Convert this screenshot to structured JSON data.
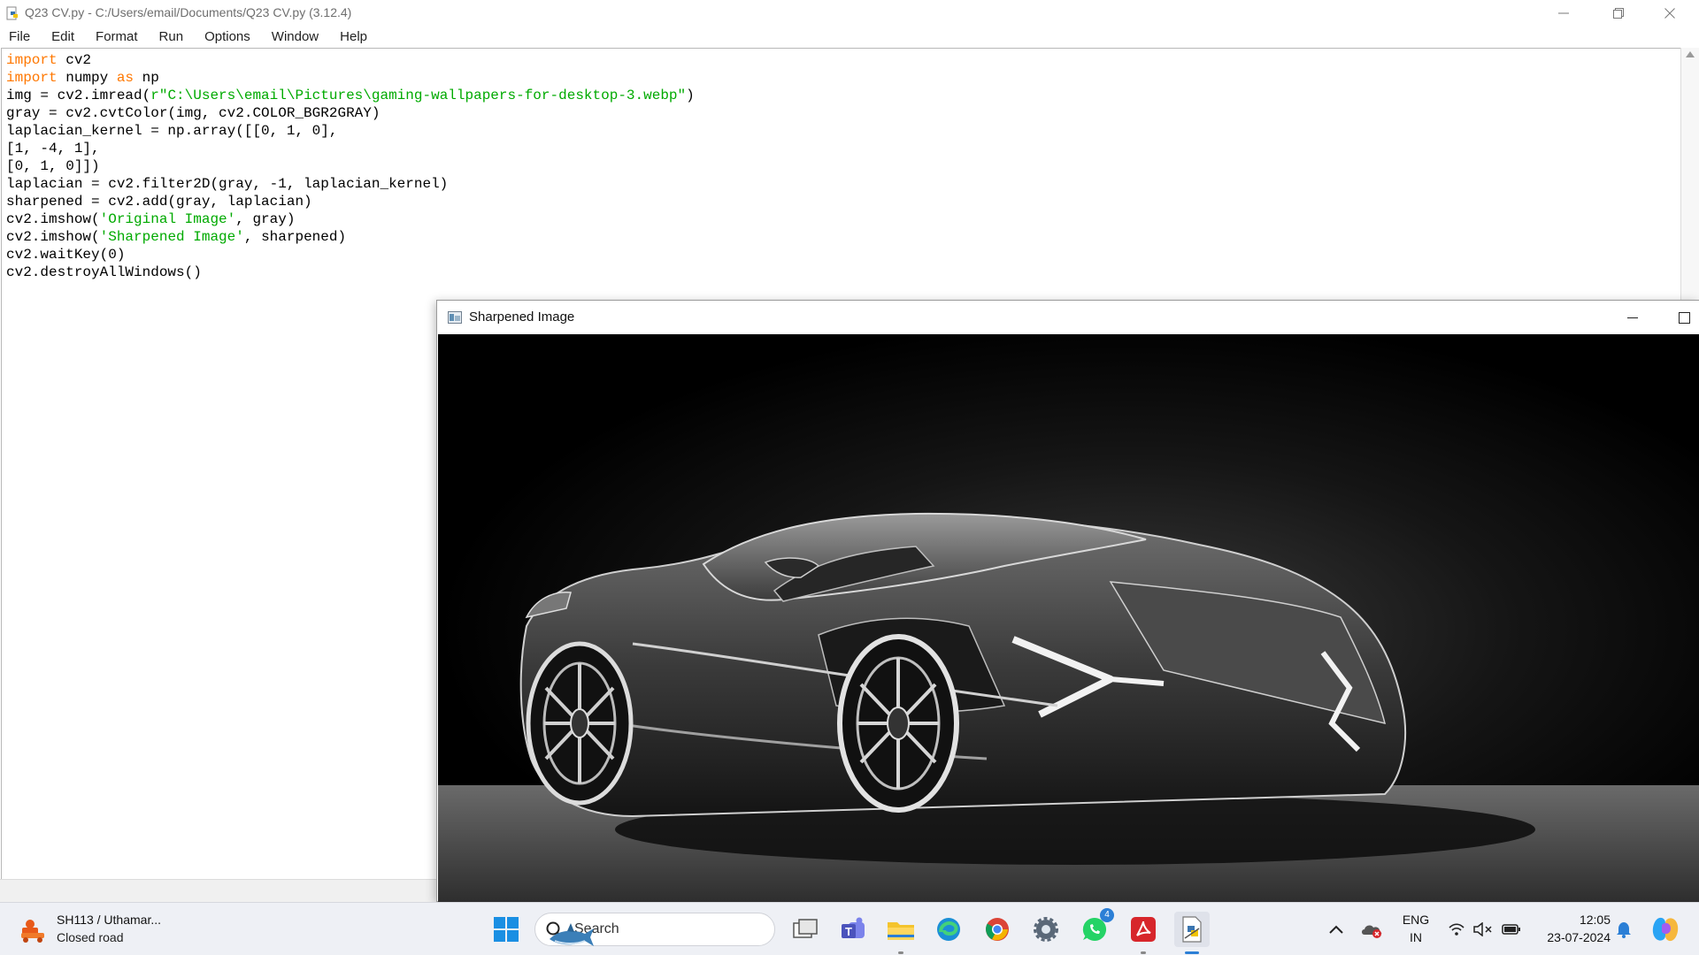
{
  "idle": {
    "title": "Q23 CV.py - C:/Users/email/Documents/Q23 CV.py (3.12.4)",
    "menu": [
      "File",
      "Edit",
      "Format",
      "Run",
      "Options",
      "Window",
      "Help"
    ],
    "code_lines": [
      [
        {
          "t": "import",
          "c": "kw"
        },
        {
          "t": " cv2"
        }
      ],
      [
        {
          "t": "import",
          "c": "kw"
        },
        {
          "t": " numpy "
        },
        {
          "t": "as",
          "c": "kw"
        },
        {
          "t": " np"
        }
      ],
      [
        {
          "t": "img = cv2.imread("
        },
        {
          "t": "r\"C:\\Users\\email\\Pictures\\gaming-wallpapers-for-desktop-3.webp\"",
          "c": "str"
        },
        {
          "t": ")"
        }
      ],
      [
        {
          "t": "gray = cv2.cvtColor(img, cv2.COLOR_BGR2GRAY)"
        }
      ],
      [
        {
          "t": "laplacian_kernel = np.array([[0, 1, 0],"
        }
      ],
      [
        {
          "t": "[1, -4, 1],"
        }
      ],
      [
        {
          "t": "[0, 1, 0]])"
        }
      ],
      [
        {
          "t": "laplacian = cv2.filter2D(gray, -1, laplacian_kernel)"
        }
      ],
      [
        {
          "t": "sharpened = cv2.add(gray, laplacian)"
        }
      ],
      [
        {
          "t": "cv2.imshow("
        },
        {
          "t": "'Original Image'",
          "c": "str"
        },
        {
          "t": ", gray)"
        }
      ],
      [
        {
          "t": "cv2.imshow("
        },
        {
          "t": "'Sharpened Image'",
          "c": "str"
        },
        {
          "t": ", sharpened)"
        }
      ],
      [
        {
          "t": "cv2.waitKey(0)"
        }
      ],
      [
        {
          "t": "cv2.destroyAllWindows()"
        }
      ]
    ],
    "colors": {
      "keyword": "#ff7700",
      "string": "#00aa00"
    }
  },
  "cv_window": {
    "title": "Sharpened Image"
  },
  "taskbar": {
    "weather_title": "SH113 / Uthamar...",
    "weather_subtitle": "Closed road",
    "search_placeholder": "Search",
    "whatsapp_badge": "4",
    "language_line1": "ENG",
    "language_line2": "IN",
    "time": "12:05",
    "date": "23-07-2024",
    "icons": [
      "start-icon",
      "search-icon",
      "task-view-icon",
      "teams-icon",
      "file-explorer-icon",
      "edge-icon",
      "chrome-icon",
      "settings-icon",
      "whatsapp-icon",
      "acrobat-icon",
      "idle-icon",
      "chevron-up-icon",
      "onedrive-icon",
      "wifi-icon",
      "volume-muted-icon",
      "battery-icon",
      "notification-icon",
      "copilot-icon"
    ]
  }
}
